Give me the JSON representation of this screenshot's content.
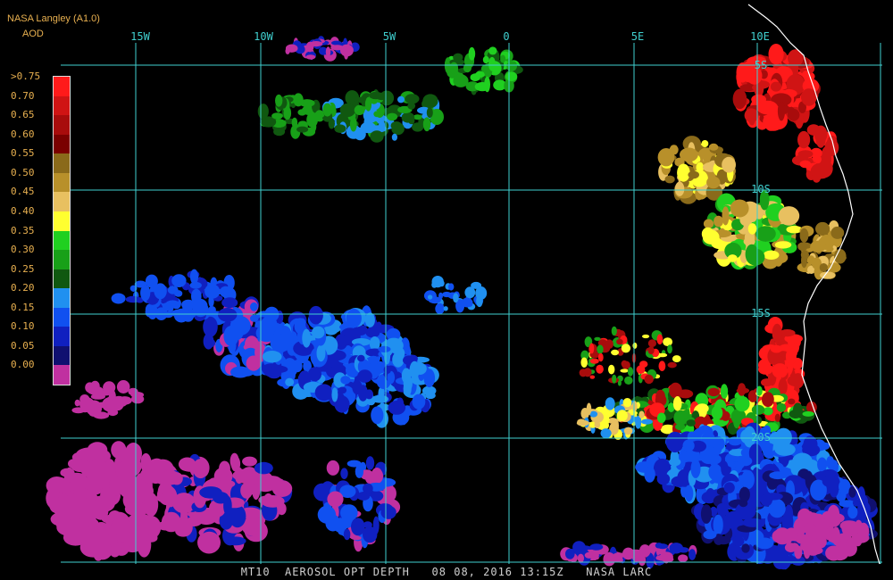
{
  "header": {
    "title": "NASA Langley (A1.0)",
    "product": "AOD"
  },
  "legend": {
    "labels": [
      ">0.75",
      "0.70",
      "0.65",
      "0.60",
      "0.55",
      "0.50",
      "0.45",
      "0.40",
      "0.35",
      "0.30",
      "0.25",
      "0.20",
      "0.15",
      "0.10",
      "0.05",
      "0.00"
    ],
    "colors": [
      "#ff1a1a",
      "#d01414",
      "#a80c0c",
      "#7a0000",
      "#8a6a1a",
      "#b8902a",
      "#e8c060",
      "#ffff30",
      "#20d020",
      "#18a018",
      "#105810",
      "#2090f0",
      "#1050f0",
      "#1020c0",
      "#101070",
      "#c030a0"
    ]
  },
  "grid": {
    "lon_labels": [
      "15W",
      "10W",
      "5W",
      "0",
      "5E",
      "10E"
    ],
    "lat_labels": [
      "5S",
      "10S",
      "15S",
      "20S"
    ]
  },
  "footer": {
    "text": "MT10  AEROSOL OPT DEPTH   08 08, 2016 13:15Z   NASA LARC"
  },
  "colors": {
    "grid": "#40d0d0",
    "coast": "#ffffff",
    "label": "#e8b050"
  }
}
